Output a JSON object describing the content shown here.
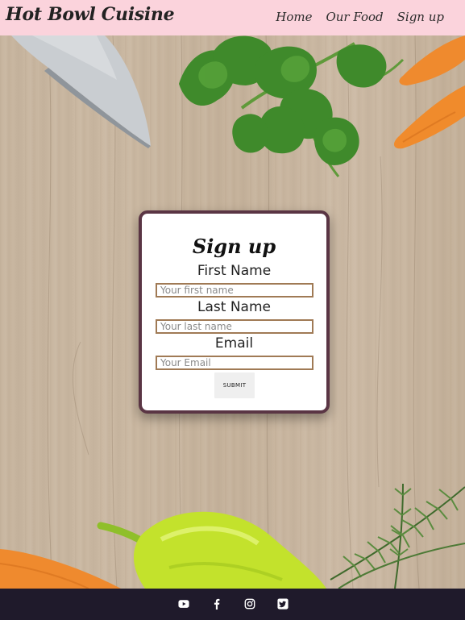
{
  "header": {
    "brand": "Hot Bowl Cuisine",
    "nav": [
      "Home",
      "Our Food",
      "Sign up"
    ]
  },
  "form": {
    "title": "Sign up",
    "fields": [
      {
        "label": "First Name",
        "placeholder": "Your first name",
        "value": ""
      },
      {
        "label": "Last Name",
        "placeholder": "Your last name",
        "value": ""
      },
      {
        "label": "Email",
        "placeholder": "Your Email",
        "value": ""
      }
    ],
    "submit_label": "SUBMIT"
  },
  "footer": {
    "social_icons": [
      "youtube-icon",
      "facebook-icon",
      "instagram-icon",
      "twitter-icon"
    ]
  },
  "colors": {
    "header_bg": "#fbd3dc",
    "footer_bg": "#1f1a2b",
    "card_border": "#5a3544",
    "input_border": "#a07a55"
  }
}
